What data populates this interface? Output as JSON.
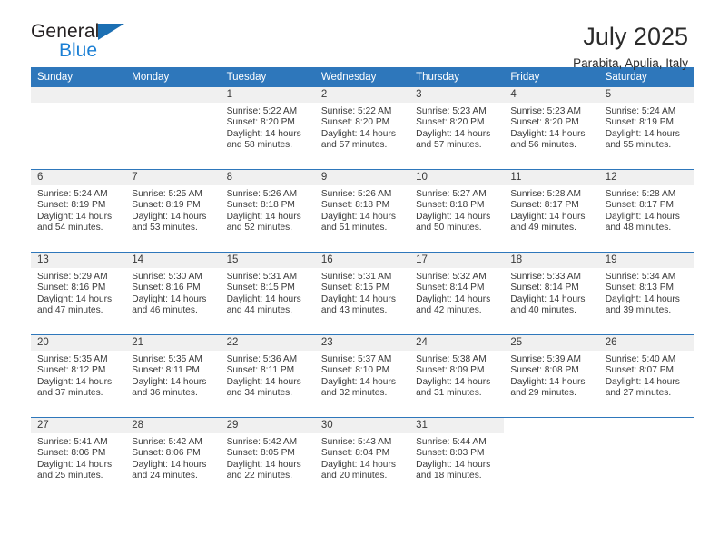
{
  "logo": {
    "word_primary": "General",
    "word_secondary": "Blue",
    "triangle_icon": "triangle-icon",
    "primary_color": "#231f20",
    "secondary_color": "#1b7fd4"
  },
  "header": {
    "month_title": "July 2025",
    "location": "Parabita, Apulia, Italy"
  },
  "theme": {
    "header_blue": "#2e77bb",
    "daynum_gray": "#f0f0f0",
    "text_color": "#3a3a3a"
  },
  "weekday_headers": [
    "Sunday",
    "Monday",
    "Tuesday",
    "Wednesday",
    "Thursday",
    "Friday",
    "Saturday"
  ],
  "weeks": [
    [
      {
        "day": "",
        "blank": true,
        "leading_pad": true,
        "sunrise": "",
        "sunset": "",
        "daylight_line1": "",
        "daylight_line2": ""
      },
      {
        "day": "",
        "blank": true,
        "leading_pad": true,
        "sunrise": "",
        "sunset": "",
        "daylight_line1": "",
        "daylight_line2": ""
      },
      {
        "day": "1",
        "sunrise": "Sunrise: 5:22 AM",
        "sunset": "Sunset: 8:20 PM",
        "daylight_line1": "Daylight: 14 hours",
        "daylight_line2": "and 58 minutes."
      },
      {
        "day": "2",
        "sunrise": "Sunrise: 5:22 AM",
        "sunset": "Sunset: 8:20 PM",
        "daylight_line1": "Daylight: 14 hours",
        "daylight_line2": "and 57 minutes."
      },
      {
        "day": "3",
        "sunrise": "Sunrise: 5:23 AM",
        "sunset": "Sunset: 8:20 PM",
        "daylight_line1": "Daylight: 14 hours",
        "daylight_line2": "and 57 minutes."
      },
      {
        "day": "4",
        "sunrise": "Sunrise: 5:23 AM",
        "sunset": "Sunset: 8:20 PM",
        "daylight_line1": "Daylight: 14 hours",
        "daylight_line2": "and 56 minutes."
      },
      {
        "day": "5",
        "sunrise": "Sunrise: 5:24 AM",
        "sunset": "Sunset: 8:19 PM",
        "daylight_line1": "Daylight: 14 hours",
        "daylight_line2": "and 55 minutes."
      }
    ],
    [
      {
        "day": "6",
        "sunrise": "Sunrise: 5:24 AM",
        "sunset": "Sunset: 8:19 PM",
        "daylight_line1": "Daylight: 14 hours",
        "daylight_line2": "and 54 minutes."
      },
      {
        "day": "7",
        "sunrise": "Sunrise: 5:25 AM",
        "sunset": "Sunset: 8:19 PM",
        "daylight_line1": "Daylight: 14 hours",
        "daylight_line2": "and 53 minutes."
      },
      {
        "day": "8",
        "sunrise": "Sunrise: 5:26 AM",
        "sunset": "Sunset: 8:18 PM",
        "daylight_line1": "Daylight: 14 hours",
        "daylight_line2": "and 52 minutes."
      },
      {
        "day": "9",
        "sunrise": "Sunrise: 5:26 AM",
        "sunset": "Sunset: 8:18 PM",
        "daylight_line1": "Daylight: 14 hours",
        "daylight_line2": "and 51 minutes."
      },
      {
        "day": "10",
        "sunrise": "Sunrise: 5:27 AM",
        "sunset": "Sunset: 8:18 PM",
        "daylight_line1": "Daylight: 14 hours",
        "daylight_line2": "and 50 minutes."
      },
      {
        "day": "11",
        "sunrise": "Sunrise: 5:28 AM",
        "sunset": "Sunset: 8:17 PM",
        "daylight_line1": "Daylight: 14 hours",
        "daylight_line2": "and 49 minutes."
      },
      {
        "day": "12",
        "sunrise": "Sunrise: 5:28 AM",
        "sunset": "Sunset: 8:17 PM",
        "daylight_line1": "Daylight: 14 hours",
        "daylight_line2": "and 48 minutes."
      }
    ],
    [
      {
        "day": "13",
        "sunrise": "Sunrise: 5:29 AM",
        "sunset": "Sunset: 8:16 PM",
        "daylight_line1": "Daylight: 14 hours",
        "daylight_line2": "and 47 minutes."
      },
      {
        "day": "14",
        "sunrise": "Sunrise: 5:30 AM",
        "sunset": "Sunset: 8:16 PM",
        "daylight_line1": "Daylight: 14 hours",
        "daylight_line2": "and 46 minutes."
      },
      {
        "day": "15",
        "sunrise": "Sunrise: 5:31 AM",
        "sunset": "Sunset: 8:15 PM",
        "daylight_line1": "Daylight: 14 hours",
        "daylight_line2": "and 44 minutes."
      },
      {
        "day": "16",
        "sunrise": "Sunrise: 5:31 AM",
        "sunset": "Sunset: 8:15 PM",
        "daylight_line1": "Daylight: 14 hours",
        "daylight_line2": "and 43 minutes."
      },
      {
        "day": "17",
        "sunrise": "Sunrise: 5:32 AM",
        "sunset": "Sunset: 8:14 PM",
        "daylight_line1": "Daylight: 14 hours",
        "daylight_line2": "and 42 minutes."
      },
      {
        "day": "18",
        "sunrise": "Sunrise: 5:33 AM",
        "sunset": "Sunset: 8:14 PM",
        "daylight_line1": "Daylight: 14 hours",
        "daylight_line2": "and 40 minutes."
      },
      {
        "day": "19",
        "sunrise": "Sunrise: 5:34 AM",
        "sunset": "Sunset: 8:13 PM",
        "daylight_line1": "Daylight: 14 hours",
        "daylight_line2": "and 39 minutes."
      }
    ],
    [
      {
        "day": "20",
        "sunrise": "Sunrise: 5:35 AM",
        "sunset": "Sunset: 8:12 PM",
        "daylight_line1": "Daylight: 14 hours",
        "daylight_line2": "and 37 minutes."
      },
      {
        "day": "21",
        "sunrise": "Sunrise: 5:35 AM",
        "sunset": "Sunset: 8:11 PM",
        "daylight_line1": "Daylight: 14 hours",
        "daylight_line2": "and 36 minutes."
      },
      {
        "day": "22",
        "sunrise": "Sunrise: 5:36 AM",
        "sunset": "Sunset: 8:11 PM",
        "daylight_line1": "Daylight: 14 hours",
        "daylight_line2": "and 34 minutes."
      },
      {
        "day": "23",
        "sunrise": "Sunrise: 5:37 AM",
        "sunset": "Sunset: 8:10 PM",
        "daylight_line1": "Daylight: 14 hours",
        "daylight_line2": "and 32 minutes."
      },
      {
        "day": "24",
        "sunrise": "Sunrise: 5:38 AM",
        "sunset": "Sunset: 8:09 PM",
        "daylight_line1": "Daylight: 14 hours",
        "daylight_line2": "and 31 minutes."
      },
      {
        "day": "25",
        "sunrise": "Sunrise: 5:39 AM",
        "sunset": "Sunset: 8:08 PM",
        "daylight_line1": "Daylight: 14 hours",
        "daylight_line2": "and 29 minutes."
      },
      {
        "day": "26",
        "sunrise": "Sunrise: 5:40 AM",
        "sunset": "Sunset: 8:07 PM",
        "daylight_line1": "Daylight: 14 hours",
        "daylight_line2": "and 27 minutes."
      }
    ],
    [
      {
        "day": "27",
        "sunrise": "Sunrise: 5:41 AM",
        "sunset": "Sunset: 8:06 PM",
        "daylight_line1": "Daylight: 14 hours",
        "daylight_line2": "and 25 minutes."
      },
      {
        "day": "28",
        "sunrise": "Sunrise: 5:42 AM",
        "sunset": "Sunset: 8:06 PM",
        "daylight_line1": "Daylight: 14 hours",
        "daylight_line2": "and 24 minutes."
      },
      {
        "day": "29",
        "sunrise": "Sunrise: 5:42 AM",
        "sunset": "Sunset: 8:05 PM",
        "daylight_line1": "Daylight: 14 hours",
        "daylight_line2": "and 22 minutes."
      },
      {
        "day": "30",
        "sunrise": "Sunrise: 5:43 AM",
        "sunset": "Sunset: 8:04 PM",
        "daylight_line1": "Daylight: 14 hours",
        "daylight_line2": "and 20 minutes."
      },
      {
        "day": "31",
        "sunrise": "Sunrise: 5:44 AM",
        "sunset": "Sunset: 8:03 PM",
        "daylight_line1": "Daylight: 14 hours",
        "daylight_line2": "and 18 minutes."
      },
      {
        "day": "",
        "blank": true,
        "trailing_pad": true,
        "sunrise": "",
        "sunset": "",
        "daylight_line1": "",
        "daylight_line2": ""
      },
      {
        "day": "",
        "blank": true,
        "trailing_pad": true,
        "sunrise": "",
        "sunset": "",
        "daylight_line1": "",
        "daylight_line2": ""
      }
    ]
  ]
}
